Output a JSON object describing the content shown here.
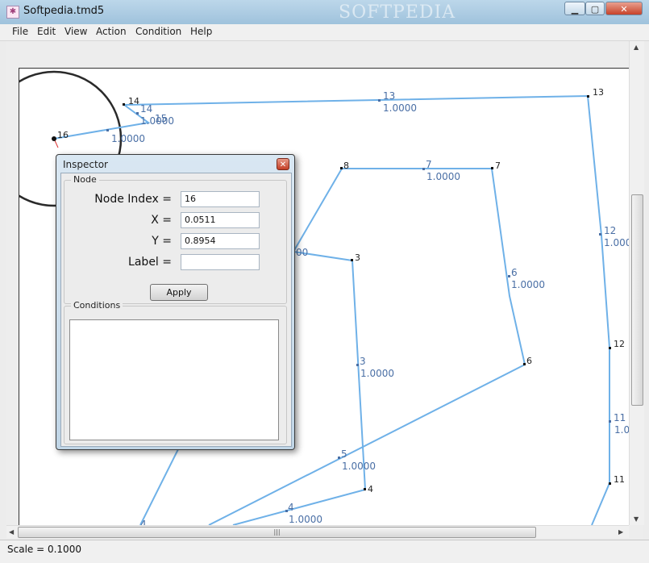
{
  "window": {
    "title": "Softpedia.tmd5",
    "watermark": "SOFTPEDIA",
    "minimize_glyph": "▁",
    "maximize_glyph": "▢",
    "close_glyph": "✕",
    "icon": "app-icon"
  },
  "menu": {
    "items": [
      "File",
      "Edit",
      "View",
      "Action",
      "Condition",
      "Help"
    ]
  },
  "status": {
    "scale": "Scale = 0.1000"
  },
  "scroll": {
    "grip": "|||"
  },
  "inspector": {
    "title": "Inspector",
    "close_glyph": "✕",
    "node_group": "Node",
    "fields": [
      {
        "label": "Node Index =",
        "value": "16"
      },
      {
        "label": "X =",
        "value": "0.0511"
      },
      {
        "label": "Y =",
        "value": "0.8954"
      },
      {
        "label": "Label =",
        "value": ""
      }
    ],
    "apply_label": "Apply",
    "conditions_group": "Conditions"
  },
  "graph": {
    "edge_color": "#6fb1e8",
    "node_labels": [
      "14",
      "16",
      "13",
      "8",
      "7",
      "3",
      "12",
      "6",
      "11",
      "4"
    ],
    "edge_labels": [
      {
        "id": "13",
        "weight": "1.0000"
      },
      {
        "id": "14",
        "weight": "1.0000"
      },
      {
        "id": "15",
        "weight": "1.0000"
      },
      {
        "id": "7",
        "weight": "1.0000"
      },
      {
        "id": "12",
        "weight": "1.000"
      },
      {
        "id": "6",
        "weight": "1.0000"
      },
      {
        "id": "3",
        "weight": "1.0000"
      },
      {
        "id": "11",
        "weight": "1.0"
      },
      {
        "id": "5",
        "weight": "1.0000"
      },
      {
        "id": "4",
        "weight": "1.0000"
      }
    ],
    "partial_weight": "00",
    "partial_label": "4"
  }
}
